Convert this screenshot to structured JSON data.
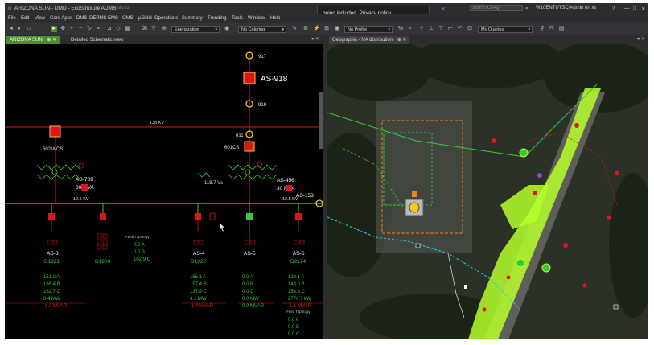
{
  "window": {
    "title": "ARIZONA SUN - DMD - EcoStruxure ADMS",
    "title_suffix": "(PREM253)",
    "search_placeholder": "Search (Ctrl+Q)",
    "user": "W10ENTUTSC\\Admin on xs",
    "help": "?",
    "minimize": "—",
    "maximize": "□",
    "close": "✕"
  },
  "notification": {
    "text": "being included. Privacy policy"
  },
  "menu": [
    "File",
    "Edit",
    "View",
    "Core Apps",
    "DMS",
    "DERMS",
    "EMS",
    "OMS",
    "µGNG",
    "Operations",
    "Summary",
    "Trending",
    "Tools",
    "Window",
    "Help"
  ],
  "toolbar": {
    "energization": "Energization",
    "coloring": "No Coloring",
    "profile": "No Profile",
    "queries": "My Queries"
  },
  "tabs_left": [
    {
      "label": "ARIZONA SUN",
      "pin": "⊕ ✕"
    },
    {
      "label": "Detailed Schematic view"
    }
  ],
  "tabs_right": [
    {
      "label": "Geographic - NA distribution",
      "pin": "⊕ ✕"
    }
  ],
  "schematic": {
    "bus_138": "138 KV",
    "bus_125_left": "12.5 KV",
    "bus_125_right": "12.5 KV",
    "nodes": {
      "n917": "917",
      "n919": "919",
      "n611": "611",
      "as918": "AS-918",
      "sw601cs": "601CS",
      "sw602mcs": "602M-CS",
      "as153": "AS-153"
    },
    "xfmr_left": {
      "name": "AS-789",
      "rating": "30 MVA"
    },
    "xfmr_right": {
      "name": "AS-456",
      "rating": "30 MVA"
    },
    "xfmr_mid_label": "118.7 Vs",
    "feeders": [
      {
        "id": "AS-8",
        "sub": "D1921",
        "vals": [
          "151.2 A",
          "166.4 B",
          "162.7 C",
          "3.4 MW",
          "-1.2 MVAR"
        ]
      },
      {
        "id": "",
        "sub": "D1900",
        "vals": []
      },
      {
        "id": "AS-4",
        "sub": "D1922",
        "vals": [
          "156.1 A",
          "157.4 B",
          "137.9 C",
          "4.1 MW",
          "-1.4 MVAR"
        ]
      },
      {
        "id": "AS-5",
        "sub": "",
        "vals": [
          "0.0 A",
          "0.0 B",
          "0.0 C",
          "0.0 MW",
          "0.0 MVAR"
        ]
      },
      {
        "id": "AS-6",
        "sub": "D2174",
        "vals": [
          "128.1 A",
          "148.0 B",
          "154.3 C",
          "2776.7 kW",
          "-1.1 MVAR"
        ]
      }
    ],
    "feed_topology": {
      "title": "Feed Topology",
      "vals": [
        "0.0 A",
        "0.0 B",
        "102.9 C"
      ]
    },
    "feed_topology_2": {
      "title": "Feed Topology",
      "vals": [
        "0.0 A",
        "0.0 B",
        "0.0 C"
      ]
    }
  },
  "colors": {
    "accent_green": "#4e8d2b",
    "bus_red": "#e0141a",
    "bus_green": "#37c837",
    "feeder_green": "#5de55d",
    "breaker_yellow": "#f6c919",
    "highlight_lime": "#b6ff2b"
  }
}
